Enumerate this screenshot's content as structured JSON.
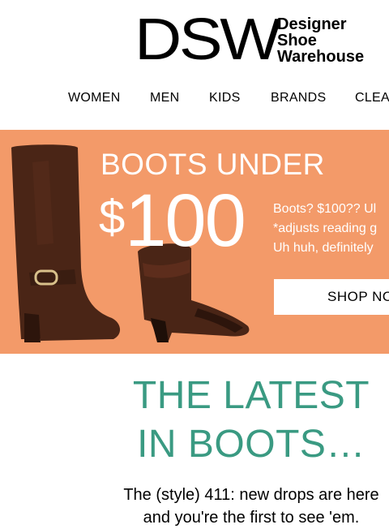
{
  "brand": {
    "mark": "DSW",
    "line1": "Designer",
    "line2": "Shoe",
    "line3": "Warehouse"
  },
  "nav": {
    "items": [
      "WOMEN",
      "MEN",
      "KIDS",
      "BRANDS",
      "CLEA"
    ]
  },
  "banner": {
    "headline": "BOOTS UNDER",
    "price_symbol": "$",
    "price_value": "100",
    "copy_line1": "Boots? $100?? Ul",
    "copy_line2": "*adjusts reading g",
    "copy_line3": "Uh huh, definitely",
    "button_label": "SHOP NO",
    "colors": {
      "background": "#f39a69",
      "boot": "#4a2516",
      "text": "#ffffff"
    }
  },
  "section": {
    "headline_line1": "THE LATEST",
    "headline_line2": "IN BOOTS…",
    "body_line1": "The (style) 411: new drops are here",
    "body_line2": "and you're the first to see 'em.",
    "accent_color": "#3a9a82"
  }
}
